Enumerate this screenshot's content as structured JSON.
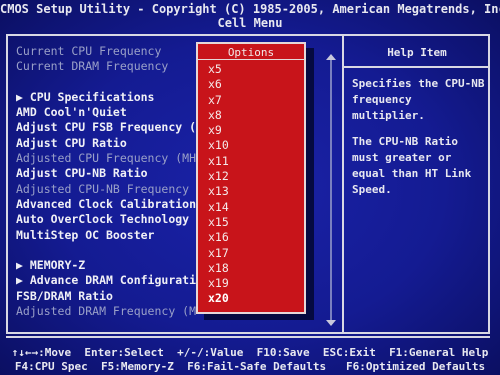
{
  "header": {
    "title": "CMOS Setup Utility - Copyright (C) 1985-2005, American Megatrends, Inc.",
    "subtitle": "Cell Menu"
  },
  "menu": {
    "items": [
      {
        "label": "Current CPU Frequency",
        "dim": true
      },
      {
        "label": "Current DRAM Frequency",
        "dim": true
      },
      {
        "label": "",
        "gap": true
      },
      {
        "label": "▶ CPU Specifications",
        "dim": false
      },
      {
        "label": "AMD Cool'n'Quiet",
        "dim": false
      },
      {
        "label": "Adjust CPU FSB Frequency (MH",
        "dim": false
      },
      {
        "label": "Adjust CPU Ratio",
        "dim": false
      },
      {
        "label": "Adjusted CPU Frequency (MHz)",
        "dim": true
      },
      {
        "label": "Adjust CPU-NB Ratio",
        "dim": false
      },
      {
        "label": "Adjusted CPU-NB Frequency (M",
        "dim": true
      },
      {
        "label": "Advanced Clock Calibration",
        "dim": false
      },
      {
        "label": "Auto OverClock Technology",
        "dim": false
      },
      {
        "label": "MultiStep OC Booster",
        "dim": false
      },
      {
        "label": "",
        "gap": true
      },
      {
        "label": "▶ MEMORY-Z",
        "dim": false
      },
      {
        "label": "▶ Advance DRAM Configuration",
        "dim": false
      },
      {
        "label": "FSB/DRAM Ratio",
        "dim": false
      },
      {
        "label": "Adjusted DRAM Frequency (MHz",
        "dim": true
      }
    ],
    "right_tail": ")"
  },
  "options_popup": {
    "title": "Options",
    "options": [
      "x5",
      "x6",
      "x7",
      "x8",
      "x9",
      "x10",
      "x11",
      "x12",
      "x13",
      "x14",
      "x15",
      "x16",
      "x17",
      "x18",
      "x19",
      "x20"
    ],
    "selected": "x20"
  },
  "help": {
    "title": "Help Item",
    "paragraphs": [
      "Specifies the CPU-NB frequency multiplier.",
      "The CPU-NB Ratio must greater or equal than HT Link Speed."
    ]
  },
  "footer": {
    "line1": "↑↓←→:Move  Enter:Select  +/-/:Value  F10:Save  ESC:Exit  F1:General Help",
    "line2": "F4:CPU Spec  F5:Memory-Z  F6:Fail-Safe Defaults   F6:Optimized Defaults"
  },
  "colors": {
    "background": "#141b92",
    "popup": "#c8141a",
    "text": "#e8e8f0"
  }
}
